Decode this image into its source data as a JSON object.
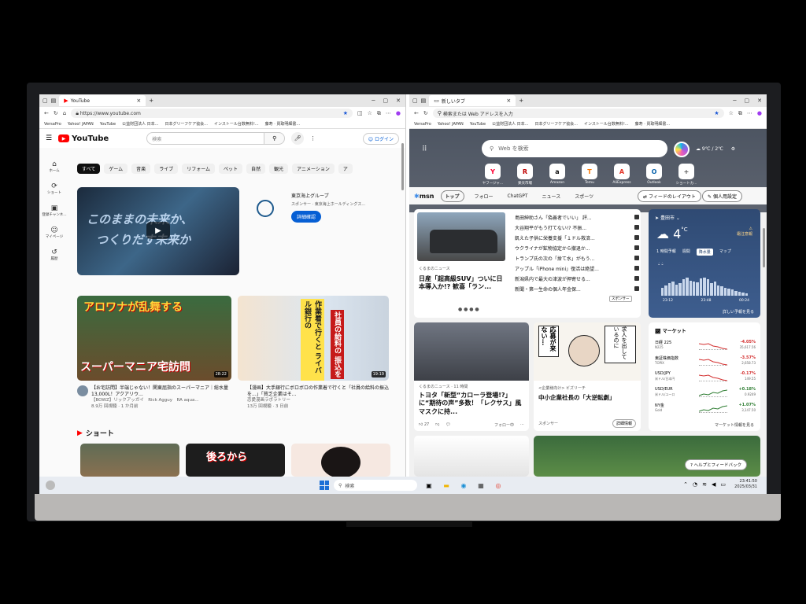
{
  "youtube": {
    "tab_title": "YouTube",
    "url": "https://www.youtube.com",
    "favorites": [
      "VersaPro",
      "Yahoo! JAPAN",
      "YouTube",
      "公益財団法人 日本...",
      "日本グリーフケア協会...",
      "インストール台数無料!...",
      "藤寿 · 買取明細書..."
    ],
    "logo_text": "YouTube",
    "search_placeholder": "検索",
    "login_label": "ログイン",
    "sidebar": [
      {
        "icon": "home-icon",
        "glyph": "⌂",
        "label": "ホーム"
      },
      {
        "icon": "shorts-icon",
        "glyph": "⟳",
        "label": "ショート"
      },
      {
        "icon": "subscriptions-icon",
        "glyph": "▣",
        "label": "登録チャンネ..."
      },
      {
        "icon": "account-icon",
        "glyph": "☺",
        "label": "マイページ"
      },
      {
        "icon": "history-icon",
        "glyph": "↺",
        "label": "履歴"
      }
    ],
    "chips": [
      "すべて",
      "ゲーム",
      "音楽",
      "ライブ",
      "リフォーム",
      "ペット",
      "自然",
      "観光",
      "アニメーション",
      "ア"
    ],
    "hero_text_1": "このままの未来か、",
    "hero_text_2": "つくりだす未来か",
    "sponsor_title": "東京海上グループ",
    "sponsor_sub": "スポンサー · 東京海上ホールディングス...",
    "sponsor_button": "詳細確認",
    "video1": {
      "thumb_top": "アロワナが乱舞する",
      "thumb_bottom": "スーパーマニア宅訪問",
      "duration": "28:22",
      "title": "【お宅訪問】半端じゃない！関東屈指のスーパーマニア｜総水量13,000L！アクアリウ...",
      "channel": "【BOWZ】リックアッガイ　Rick Agguy　RA aqua...",
      "meta": "8.9万 回視聴 · 1 か月前"
    },
    "video2": {
      "thumb_a": "作業着で行くと ライバル銀行の",
      "thumb_b": "社員の給料の 振込を",
      "duration": "19:19",
      "title": "【漫画】大手銀行にボロボロの作業着で行くと「社員の給料の振込を...」「貧乏企業はそ...",
      "channel": "恋愛漫画ラボラトリー",
      "meta": "13万 回視聴 · 3 日前"
    },
    "shorts_label": "ショート",
    "short2_text": "後ろから"
  },
  "edge": {
    "tab_title": "新しいタブ",
    "address_placeholder": "検索または Web アドレスを入力",
    "favorites": [
      "VersaPro",
      "Yahoo! JAPAN",
      "YouTube",
      "公益財団法人 日本...",
      "日本グリーフケア協会...",
      "インストール台数無料!...",
      "藤寿 · 買取明細書..."
    ],
    "search_placeholder": "Web を検索",
    "weather_top": "9℃ / 2℃",
    "apps": [
      {
        "name": "ヤフージャ...",
        "letter": "Y",
        "color": "#ff0033"
      },
      {
        "name": "楽天市場",
        "letter": "R",
        "color": "#bf0000"
      },
      {
        "name": "Amazon",
        "letter": "a",
        "color": "#111111"
      },
      {
        "name": "Temu",
        "letter": "T",
        "color": "#fb7701"
      },
      {
        "name": "AliExpress",
        "letter": "A",
        "color": "#e43225"
      },
      {
        "name": "Outlook",
        "letter": "O",
        "color": "#0a64ad"
      },
      {
        "name": "ショートカ...",
        "letter": "+",
        "color": "#555555"
      }
    ]
  },
  "msn": {
    "logo": "msn",
    "tabs": [
      "トップ",
      "フォロー",
      "ChatGPT",
      "ニュース",
      "スポーツ"
    ],
    "layout_button": "フィードのレイアウト",
    "settings_button": "個人用設定",
    "top_card": {
      "source": "くるまのニュース",
      "headline": "日産「超高級SUV」ついに日本導入か!? 歓喜「ラン...",
      "list": [
        "島田紳助さん「偽善者でいい」 評...",
        "大谷翔平がもう打てない!? 不振...",
        "飢えた子供に栄養支援「１ドル救済...",
        "ウクライナが鉱物協定から撤退か...",
        "トランプ氏の次の「捨て水」がもう...",
        "アップル「iPhone mini」復活は絶望...",
        "新潟県内で最大の津波が押寄せる...",
        "新聞・第一生命の個人年金保..."
      ],
      "sponsor_tag": "スポンサー"
    },
    "weather": {
      "city": "豊田市",
      "temp": "4",
      "unit": "°C",
      "condition": "霜注意報",
      "tabs": [
        "1 時間予報",
        "週間",
        "降水量",
        "マップ"
      ],
      "times": [
        "23:12",
        "23:48",
        "00:24"
      ],
      "more": "詳しい予報を見る",
      "rain_levels": [
        0.4,
        0.5,
        0.6,
        0.7,
        0.55,
        0.6,
        0.8,
        0.9,
        0.75,
        0.7,
        0.65,
        0.85,
        0.9,
        0.8,
        0.6,
        0.7,
        0.5,
        0.45,
        0.4,
        0.35,
        0.3,
        0.25,
        0.2,
        0.15,
        0.1
      ]
    },
    "card2": {
      "source": "くるまのニュース · 11 時間",
      "headline": "トヨタ「新型“カローラ登場!?」に“期待の声”多数！「レクサス」風マスクに持...",
      "likes": "27",
      "follow": "フォロー中"
    },
    "card3": {
      "bubble1": "応募が来ない…",
      "bubble2": "求人を出しているのに",
      "source": "<企業様向け> ビズリーチ",
      "headline": "中小企業社長の「大逆転劇」",
      "sponsor": "スポンサー",
      "button": "詳細情報"
    },
    "market": {
      "title": "マーケット",
      "rows": [
        {
          "name": "日経 225",
          "sub": "N225",
          "change": "-4.05%",
          "value": "35,617.56",
          "color": "#d32f2f"
        },
        {
          "name": "東証株価指数",
          "sub": "TOPIX",
          "change": "-3.57%",
          "value": "2,658.73",
          "color": "#d32f2f"
        },
        {
          "name": "USD/JPY",
          "sub": "米ドル/日本円",
          "change": "-0.17%",
          "value": "149.55",
          "color": "#d32f2f"
        },
        {
          "name": "USD/EUR",
          "sub": "米ドル/ユーロ",
          "change": "+0.18%",
          "value": "0.9249",
          "color": "#2e7d32"
        },
        {
          "name": "NY金",
          "sub": "Gold",
          "change": "+1.07%",
          "value": "3,147.50",
          "color": "#2e7d32"
        }
      ],
      "more": "マーケット情報を見る"
    },
    "help_button": "ヘルプとフィードバック"
  },
  "taskbar": {
    "search_placeholder": "検索",
    "time": "23:41:50",
    "date": "2025/03/31"
  }
}
